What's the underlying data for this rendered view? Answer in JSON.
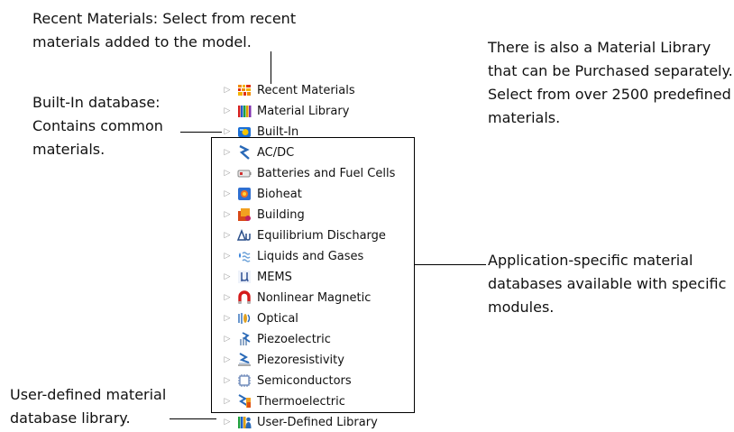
{
  "callouts": {
    "recent": [
      "Recent Materials: Select from recent",
      "materials added to the model."
    ],
    "builtin": [
      "Built-In database:",
      "Contains common",
      "materials."
    ],
    "library": [
      "There is also a Material Library",
      "that can be Purchased separately.",
      "Select from over 2500 predefined",
      "materials."
    ],
    "application": [
      "Application-specific material",
      "databases available with specific",
      "modules."
    ],
    "user": [
      "User-defined material",
      "database library."
    ]
  },
  "tree": {
    "items": [
      {
        "label": "Recent Materials",
        "icon": "recent-materials-icon"
      },
      {
        "label": "Material Library",
        "icon": "material-library-icon"
      },
      {
        "label": "Built-In",
        "icon": "built-in-icon"
      },
      {
        "label": "AC/DC",
        "icon": "acdc-icon"
      },
      {
        "label": "Batteries and Fuel Cells",
        "icon": "battery-icon"
      },
      {
        "label": "Bioheat",
        "icon": "bioheat-icon"
      },
      {
        "label": "Building",
        "icon": "building-icon"
      },
      {
        "label": "Equilibrium Discharge",
        "icon": "equilibrium-discharge-icon"
      },
      {
        "label": "Liquids and Gases",
        "icon": "liquids-gases-icon"
      },
      {
        "label": "MEMS",
        "icon": "mems-icon"
      },
      {
        "label": "Nonlinear Magnetic",
        "icon": "magnet-icon"
      },
      {
        "label": "Optical",
        "icon": "optical-icon"
      },
      {
        "label": "Piezoelectric",
        "icon": "piezoelectric-icon"
      },
      {
        "label": "Piezoresistivity",
        "icon": "piezoresistivity-icon"
      },
      {
        "label": "Semiconductors",
        "icon": "semiconductor-icon"
      },
      {
        "label": "Thermoelectric",
        "icon": "thermoelectric-icon"
      },
      {
        "label": "User-Defined Library",
        "icon": "user-defined-library-icon"
      }
    ],
    "expand_glyph": "▷"
  }
}
